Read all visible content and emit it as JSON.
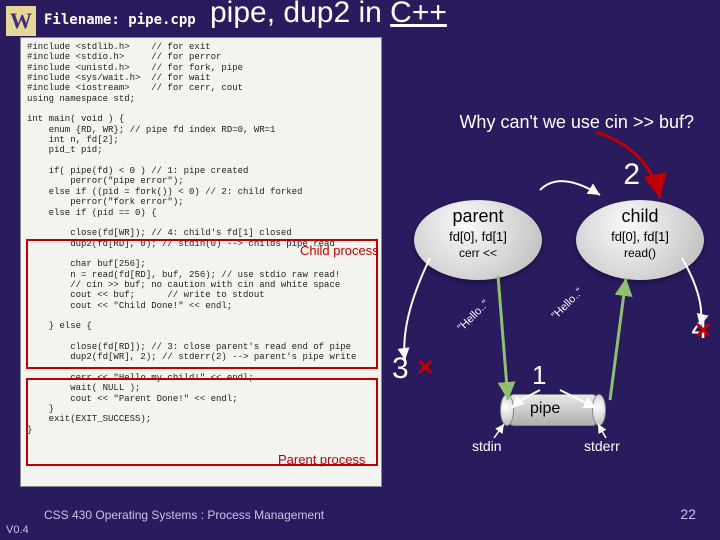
{
  "logo": "W",
  "filename": "Filename: pipe.cpp",
  "title_a": "pipe, dup2 in ",
  "title_b": "C++",
  "question": "Why can't we use cin >> buf?",
  "numbers": {
    "n1": "1",
    "n2": "2",
    "n3": "3",
    "n4": "4"
  },
  "parent": {
    "name": "parent",
    "fd": "fd[0], fd[1]",
    "op": "cerr <<"
  },
  "child": {
    "name": "child",
    "fd": "fd[0], fd[1]",
    "op": "read()"
  },
  "msg_to_child": "\"Hello..\"",
  "msg_to_parent": "\"Hello..\"",
  "pipe_label": "pipe",
  "stdin": "stdin",
  "stderr": "stderr",
  "child_proc": "Child process",
  "parent_proc": "Parent process",
  "footer": "CSS 430 Operating Systems : Process Management",
  "version": "V0.4",
  "page": "22",
  "code": "#include <stdlib.h>    // for exit\n#include <stdio.h>     // for perror\n#include <unistd.h>    // for fork, pipe\n#include <sys/wait.h>  // for wait\n#include <iostream>    // for cerr, cout\nusing namespace std;\n\nint main( void ) {\n    enum {RD, WR}; // pipe fd index RD=0, WR=1\n    int n, fd[2];\n    pid_t pid;\n\n    if( pipe(fd) < 0 ) // 1: pipe created\n        perror(\"pipe error\");\n    else if ((pid = fork()) < 0) // 2: child forked\n        perror(\"fork error\");\n    else if (pid == 0) {\n\n        close(fd[WR]); // 4: child's fd[1] closed\n        dup2(fd[RD], 0); // stdin(0) --> childs pipe read\n\n        char buf[256];\n        n = read(fd[RD], buf, 256); // use stdio raw read!\n        // cin >> buf; no caution with cin and white space\n        cout << buf;      // write to stdout\n        cout << \"Child Done!\" << endl;\n\n    } else {\n\n        close(fd[RD]); // 3: close parent's read end of pipe\n        dup2(fd[WR], 2); // stderr(2) --> parent's pipe write\n\n        cerr << \"Hello my child!\" << endl;\n        wait( NULL );\n        cout << \"Parent Done!\" << endl;\n    }\n    exit(EXIT_SUCCESS);\n}"
}
